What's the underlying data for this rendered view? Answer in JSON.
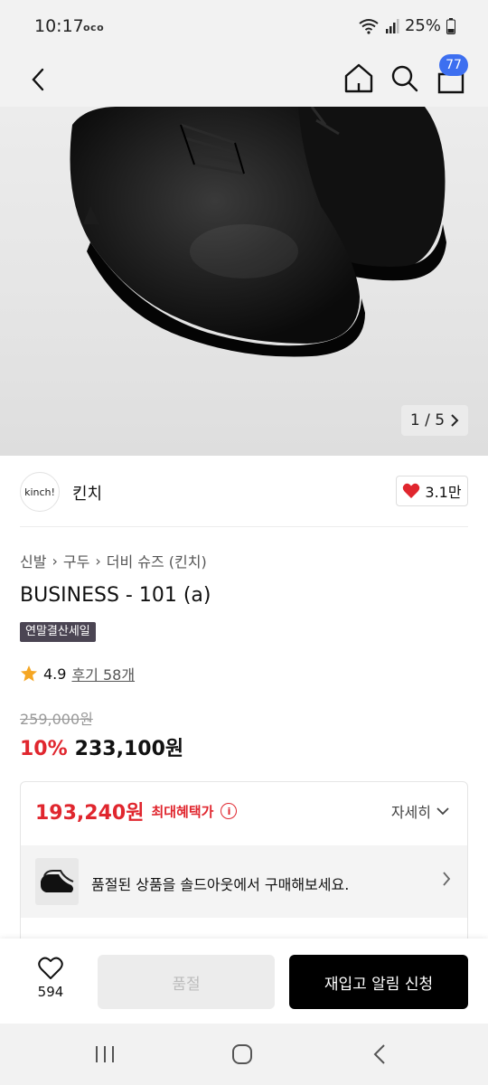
{
  "status": {
    "time": "10:17",
    "extra": "oco",
    "battery": "25%"
  },
  "nav": {
    "cart_count": "77"
  },
  "gallery": {
    "counter": "1 / 5"
  },
  "brand": {
    "logo_text": "kinch!",
    "name": "킨치",
    "likes": "3.1만"
  },
  "breadcrumb": [
    "신발",
    "구두",
    "더비 슈즈 (킨치)"
  ],
  "product": {
    "title": "BUSINESS - 101 (a)",
    "tag": "연말결산세일",
    "rating": "4.9",
    "reviews": "후기 58개",
    "original_price": "259,000원",
    "discount": "10%",
    "price": "233,100원"
  },
  "benefit": {
    "price": "193,240원",
    "label": "최대혜택가",
    "detail_label": "자세히",
    "soldout_message": "품절된 상품을 솔드아웃에서 구매해보세요."
  },
  "bottom": {
    "wish_count": "594",
    "soldout_label": "품절",
    "restock_label": "재입고 알림 신청"
  },
  "colors": {
    "accent_red": "#e0262e",
    "badge_blue": "#3d6ff0",
    "tag_bg": "#4b4553"
  }
}
